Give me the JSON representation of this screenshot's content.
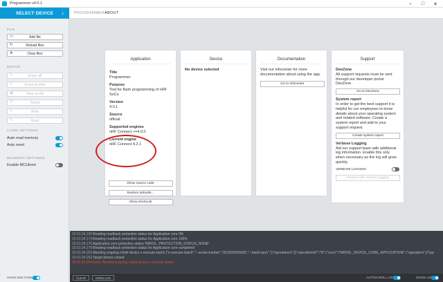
{
  "window": {
    "title": "Programmer v4.0.1",
    "minimize": "–",
    "maximize": "□",
    "close": "✕"
  },
  "header": {
    "select_device": "SELECT DEVICE",
    "tabs": [
      {
        "label": "PROGRAMMER"
      },
      {
        "label": "ABOUT"
      }
    ]
  },
  "sidebar": {
    "file_heading": "FILE",
    "file_buttons": [
      {
        "label": "Add file"
      },
      {
        "label": "Reload files"
      },
      {
        "label": "Clear files"
      }
    ],
    "device_heading": "DEVICE",
    "device_buttons": [
      {
        "label": "Erase all"
      },
      {
        "label": "Erase & write"
      },
      {
        "label": "Save as file"
      },
      {
        "label": "Reset"
      },
      {
        "label": "Write"
      },
      {
        "label": "Read"
      }
    ],
    "jlink_heading": "J-LINK SETTINGS",
    "auto_read": {
      "label": "Auto read memory",
      "on": true
    },
    "auto_reset": {
      "label": "Auto reset",
      "on": true
    },
    "mcuboot_heading": "MCUBOOT SETTINGS",
    "enable_mcuboot": {
      "label": "Enable MCUboot",
      "on": false
    },
    "show_side_panel": "SHOW SIDE PANEL"
  },
  "cards": {
    "application": {
      "title": "Application",
      "name_key": "Title",
      "name_val": "Programmer",
      "purpose_key": "Purpose",
      "purpose_val": "Tool for flash programming of nRF SoCs",
      "version_key": "Version",
      "version_val": "4.0.1",
      "source_key": "Source",
      "source_val": "official",
      "engines_key": "Supported engines",
      "engines_val": "nRF Connect >=4.0.0",
      "engine_key": "Current engine",
      "engine_val": "nRF Connect 4.2.1",
      "btn_source": "Show source code",
      "btn_restore": "Restore defaults...",
      "btn_shortcuts": "Show shortcuts"
    },
    "device": {
      "title": "Device",
      "body": "No device selected"
    },
    "documentation": {
      "title": "Documentation",
      "body": "Visit our Infocenter for more documentation about using the app.",
      "btn": "Go to Infocenter"
    },
    "support": {
      "title": "Support",
      "devzone_key": "DevZone",
      "devzone_val": "All support requests must be sent through our developer portal DevZone.",
      "devzone_btn": "Go to DevZone",
      "report_key": "System report",
      "report_val": "In order to get the best support it is helpful for our employees to know details about your operating system and related software. Create a system report and add to your support request.",
      "report_btn": "Create system report",
      "verbose_key": "Verbose Logging",
      "verbose_val": "Aid our support team with additional log information. Enable this only when necessary as the log will grow quickly.",
      "verbose_toggle_label": "VERBOSE LOGGING",
      "verbose_on": false,
      "restart_btn": "Restart with verbose logging"
    }
  },
  "log": [
    {
      "ts": "15:01:34.150",
      "msg": "Reading readback protection status for Application core 0%",
      "err": false
    },
    {
      "ts": "15:01:34.174",
      "msg": "Reading readback protection status for Application core 100%",
      "err": false
    },
    {
      "ts": "15:01:34.175",
      "msg": "Application core protection status 'NRFDL_PROTECTION_STATUS_NONE'",
      "err": false
    },
    {
      "ts": "15:01:34.175",
      "msg": "Reading readback protection status for Application core completed",
      "err": false
    },
    {
      "ts": "15:01:34.263",
      "msg": "Aborting ongoing nrfutil device x-execute-batch [\"x-execute-batch\",\"--serial-number\",\"001050025606\",\"--batch-json\",\"{\\\"operations\\\":[{\\\"operationId\\\":\\\"0\\\",\\\"core\\\":\\\"NRFDL_DEVICE_CORE_APPLICATION\\\",\\\"operation\\\":{\\\"typ",
      "err": false
    },
    {
      "ts": "15:01:34.263",
      "msg": "Target device closed",
      "err": false
    },
    {
      "ts": "15:01:34.504",
      "msg": "Error: Aborted ongoing nrfutil device x-execute-batch",
      "err": true
    }
  ],
  "bottombar": {
    "clear_log": "CLEAR LOG",
    "open_log_file": "OPEN LOG FILE",
    "autoscroll_label": "AUTOSCROLL LOG",
    "autoscroll_on": true,
    "show_log_label": "SHOW LOG",
    "show_log_on": true,
    "show_side_panel_on": true
  },
  "colors": {
    "accent": "#0a9bd6",
    "log_bg": "#3c4147",
    "error": "#e74c3c",
    "annotation": "#d21b1b"
  }
}
